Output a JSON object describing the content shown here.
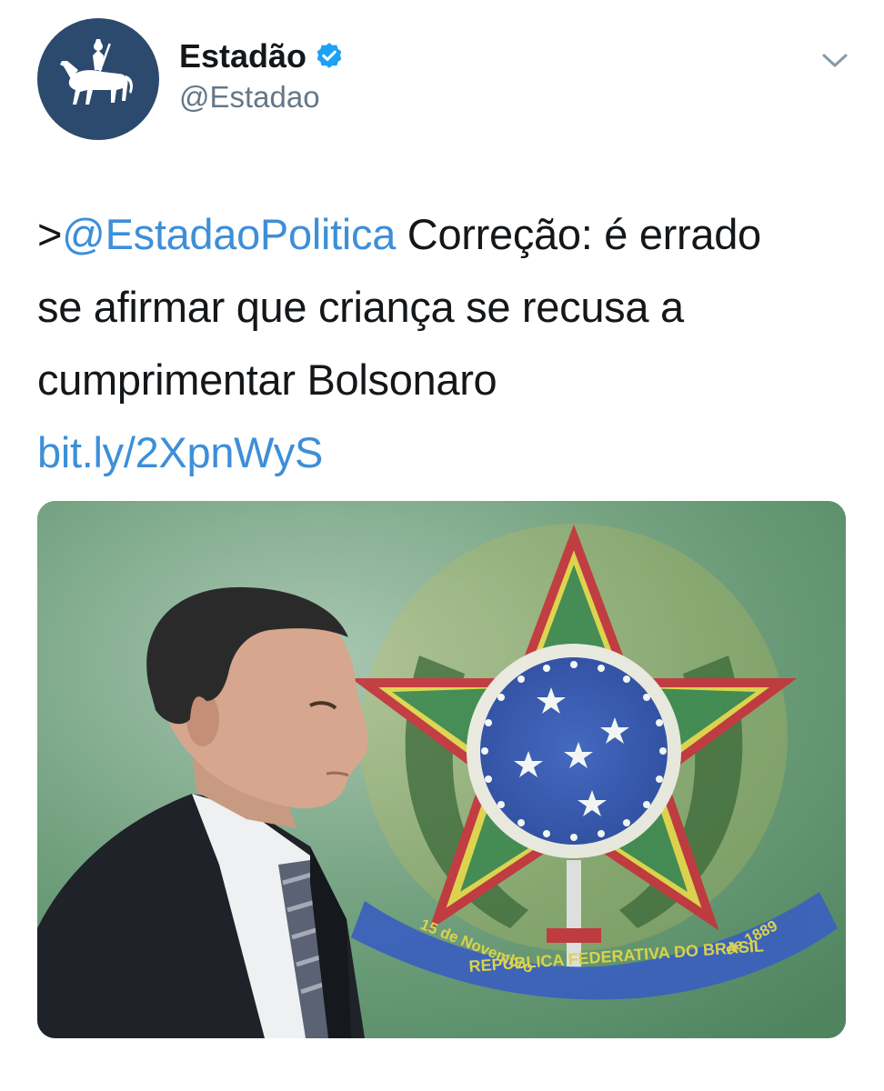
{
  "author": {
    "display_name": "Estadão",
    "handle": "@Estadao",
    "avatar_icon": "horseman-logo-icon",
    "verified_icon": "verified-badge-icon"
  },
  "menu": {
    "icon": "chevron-down-icon"
  },
  "tweet": {
    "prefix": ">",
    "mention": "@EstadaoPolitica",
    "line1_rest": " Correção: é errado",
    "line2": "se afirmar que criança se recusa a",
    "line3": "cumprimentar Bolsonaro",
    "link": "bit.ly/2XpnWyS"
  },
  "media": {
    "banner_line1": "REPÚBLICA FEDERATIVA DO BRASIL",
    "banner_left": "15 de Novembro",
    "banner_right": "de 1889"
  },
  "colors": {
    "link": "#3d8fd8",
    "verified": "#1da1f2",
    "avatar_bg": "#2c4a6e"
  }
}
